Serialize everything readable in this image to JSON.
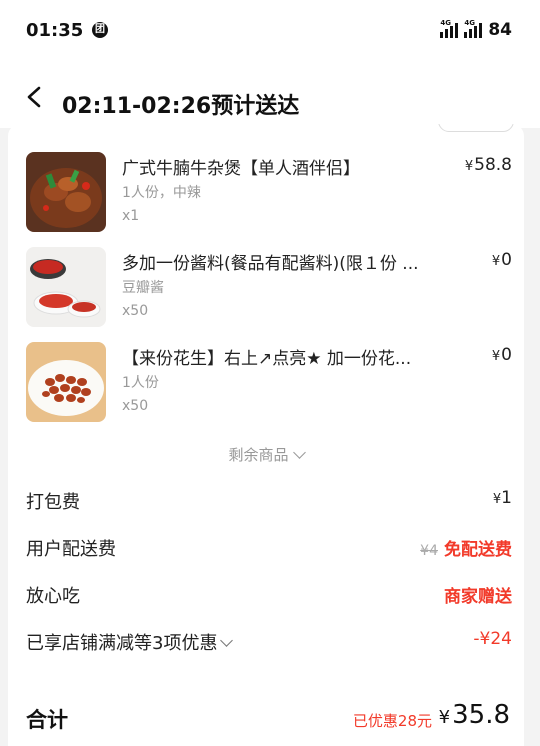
{
  "status_bar": {
    "time": "01:35",
    "app_badge": "团",
    "net1": "4G",
    "net2": "4G",
    "battery": "84"
  },
  "header": {
    "title": "02:11-02:26预计送达"
  },
  "items": [
    {
      "name": "广式牛腩牛杂煲【单人酒伴侣】",
      "spec": "1人份，中辣",
      "qty": "x1",
      "currency": "¥",
      "price": "58.8"
    },
    {
      "name": "多加一份酱料(餐品有配酱料)(限１份 ...",
      "spec": "豆瓣酱",
      "qty": "x50",
      "currency": "¥",
      "price": "0"
    },
    {
      "name": "【来份花生】右上↗点亮★ 加一份花...",
      "spec": "1人份",
      "qty": "x50",
      "currency": "¥",
      "price": "0"
    }
  ],
  "more_items": "剩余商品",
  "fees": {
    "packing": {
      "label": "打包费",
      "currency": "¥",
      "value": "1"
    },
    "delivery": {
      "label": "用户配送费",
      "original": "¥4",
      "value": "免配送费"
    },
    "assurance": {
      "label": "放心吃",
      "value": "商家赠送"
    },
    "discount": {
      "label": "已享店铺满减等3项优惠",
      "value": "-¥24"
    }
  },
  "total": {
    "label": "合计",
    "saved": "已优惠28元",
    "currency": "¥",
    "amount": "35.8"
  },
  "colors": {
    "accent": "#f23a2a",
    "text": "#222222",
    "muted": "#999999"
  }
}
